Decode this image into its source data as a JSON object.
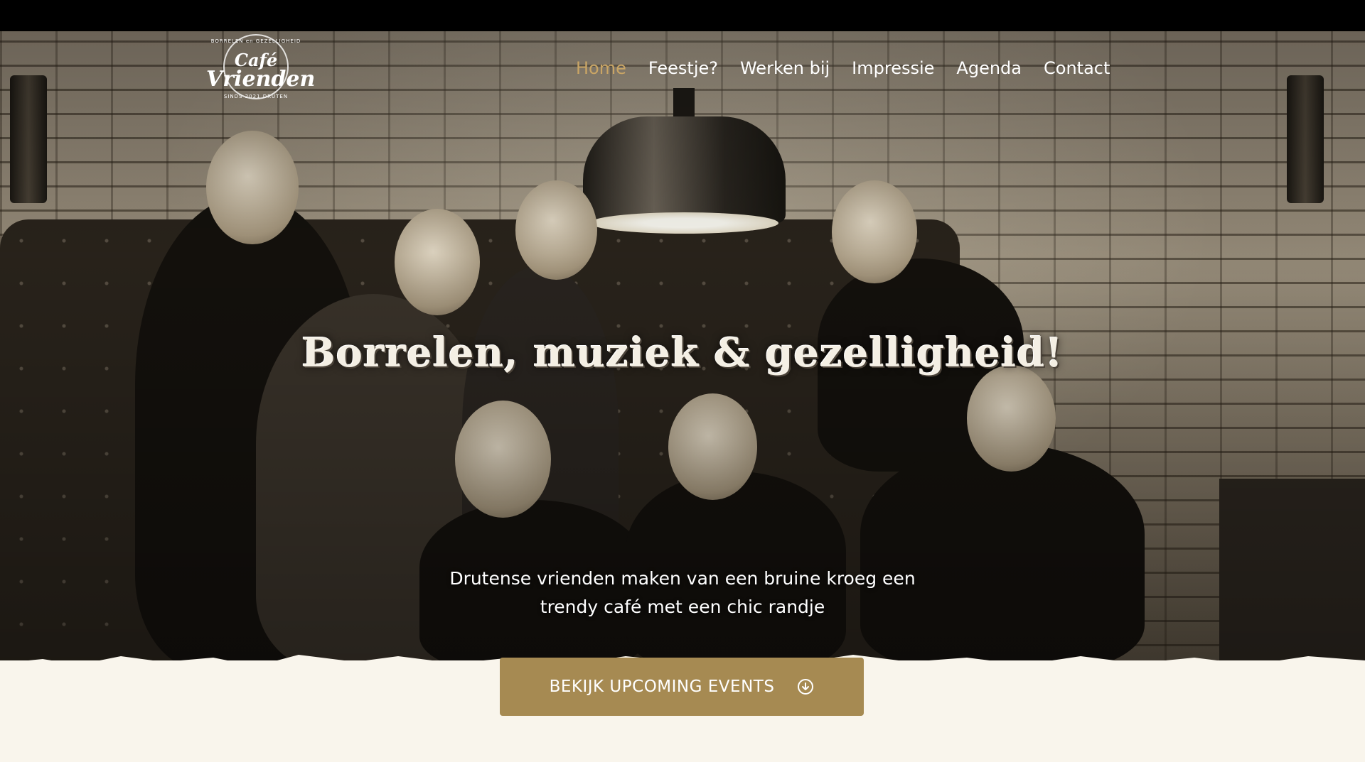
{
  "logo": {
    "line1": "Café",
    "line2": "Vrienden",
    "top_text": "BORRELEN en GEZELLIGHEID",
    "bottom_text": "SINDS 2021 DRUTEN"
  },
  "nav": {
    "items": [
      {
        "label": "Home",
        "active": true
      },
      {
        "label": "Feestje?",
        "active": false
      },
      {
        "label": "Werken bij",
        "active": false
      },
      {
        "label": "Impressie",
        "active": false
      },
      {
        "label": "Agenda",
        "active": false
      },
      {
        "label": "Contact",
        "active": false
      }
    ]
  },
  "hero": {
    "headline": "Borrelen, muziek & gezelligheid!",
    "subtitle_line1": "Drutense vrienden maken van een bruine kroeg een",
    "subtitle_line2": "trendy café met een chic randje"
  },
  "cta": {
    "label": "BEKIJK UPCOMING EVENTS",
    "icon": "arrow-down-circle-icon"
  },
  "colors": {
    "accent": "#c9a565",
    "button": "#a68a52",
    "paper": "#f9f5ec"
  }
}
